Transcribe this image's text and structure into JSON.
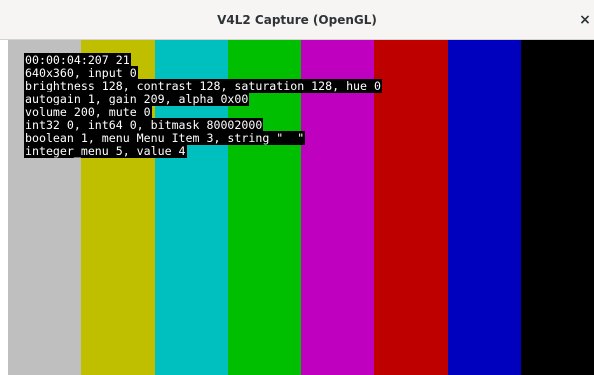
{
  "window": {
    "title": "V4L2 Capture (OpenGL)",
    "close_label": "×"
  },
  "test_pattern": {
    "bars": [
      {
        "name": "gray",
        "color": "#bfbfbf"
      },
      {
        "name": "yellow",
        "color": "#bfbf00"
      },
      {
        "name": "cyan",
        "color": "#00bfbf"
      },
      {
        "name": "green",
        "color": "#00bf00"
      },
      {
        "name": "magenta",
        "color": "#bf00bf"
      },
      {
        "name": "red",
        "color": "#bf0000"
      },
      {
        "name": "blue",
        "color": "#0000bf"
      },
      {
        "name": "black",
        "color": "#000000"
      }
    ]
  },
  "osd": {
    "lines": [
      "00:00:04:207 21",
      "640x360, input 0",
      "brightness 128, contrast 128, saturation 128, hue 0",
      "autogain 1, gain 209, alpha 0x00",
      "volume 200, mute 0",
      "int32 0, int64 0, bitmask 80002000",
      "boolean 1, menu Menu Item 3, string \"  \"",
      "integer_menu 5, value 4"
    ]
  }
}
